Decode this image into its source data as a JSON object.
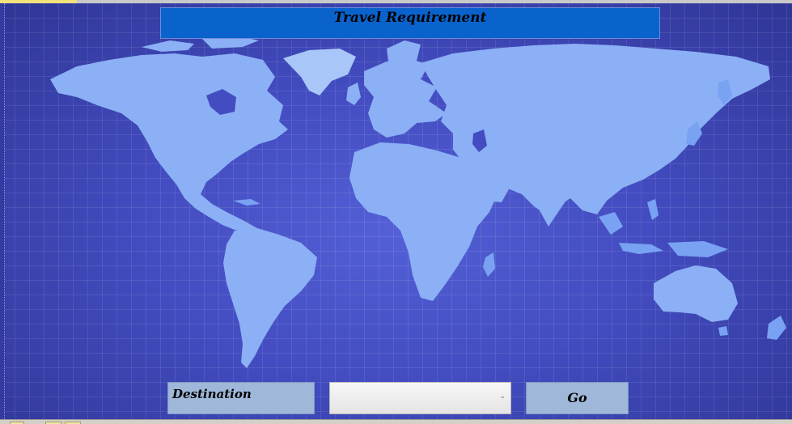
{
  "form": {
    "title": "Travel Requirement",
    "destination_label": "Destination",
    "destination_value": "",
    "go_label": "Go",
    "dropdown_arrow": "⌄"
  },
  "theme": {
    "background": "#434cc0",
    "title_bar": "#0a63cc",
    "panel": "#9fb7d8",
    "map_land": "#8bb0f5"
  },
  "icons": {
    "background_image": "world-map-icon",
    "dropdown": "chevron-down-icon"
  }
}
